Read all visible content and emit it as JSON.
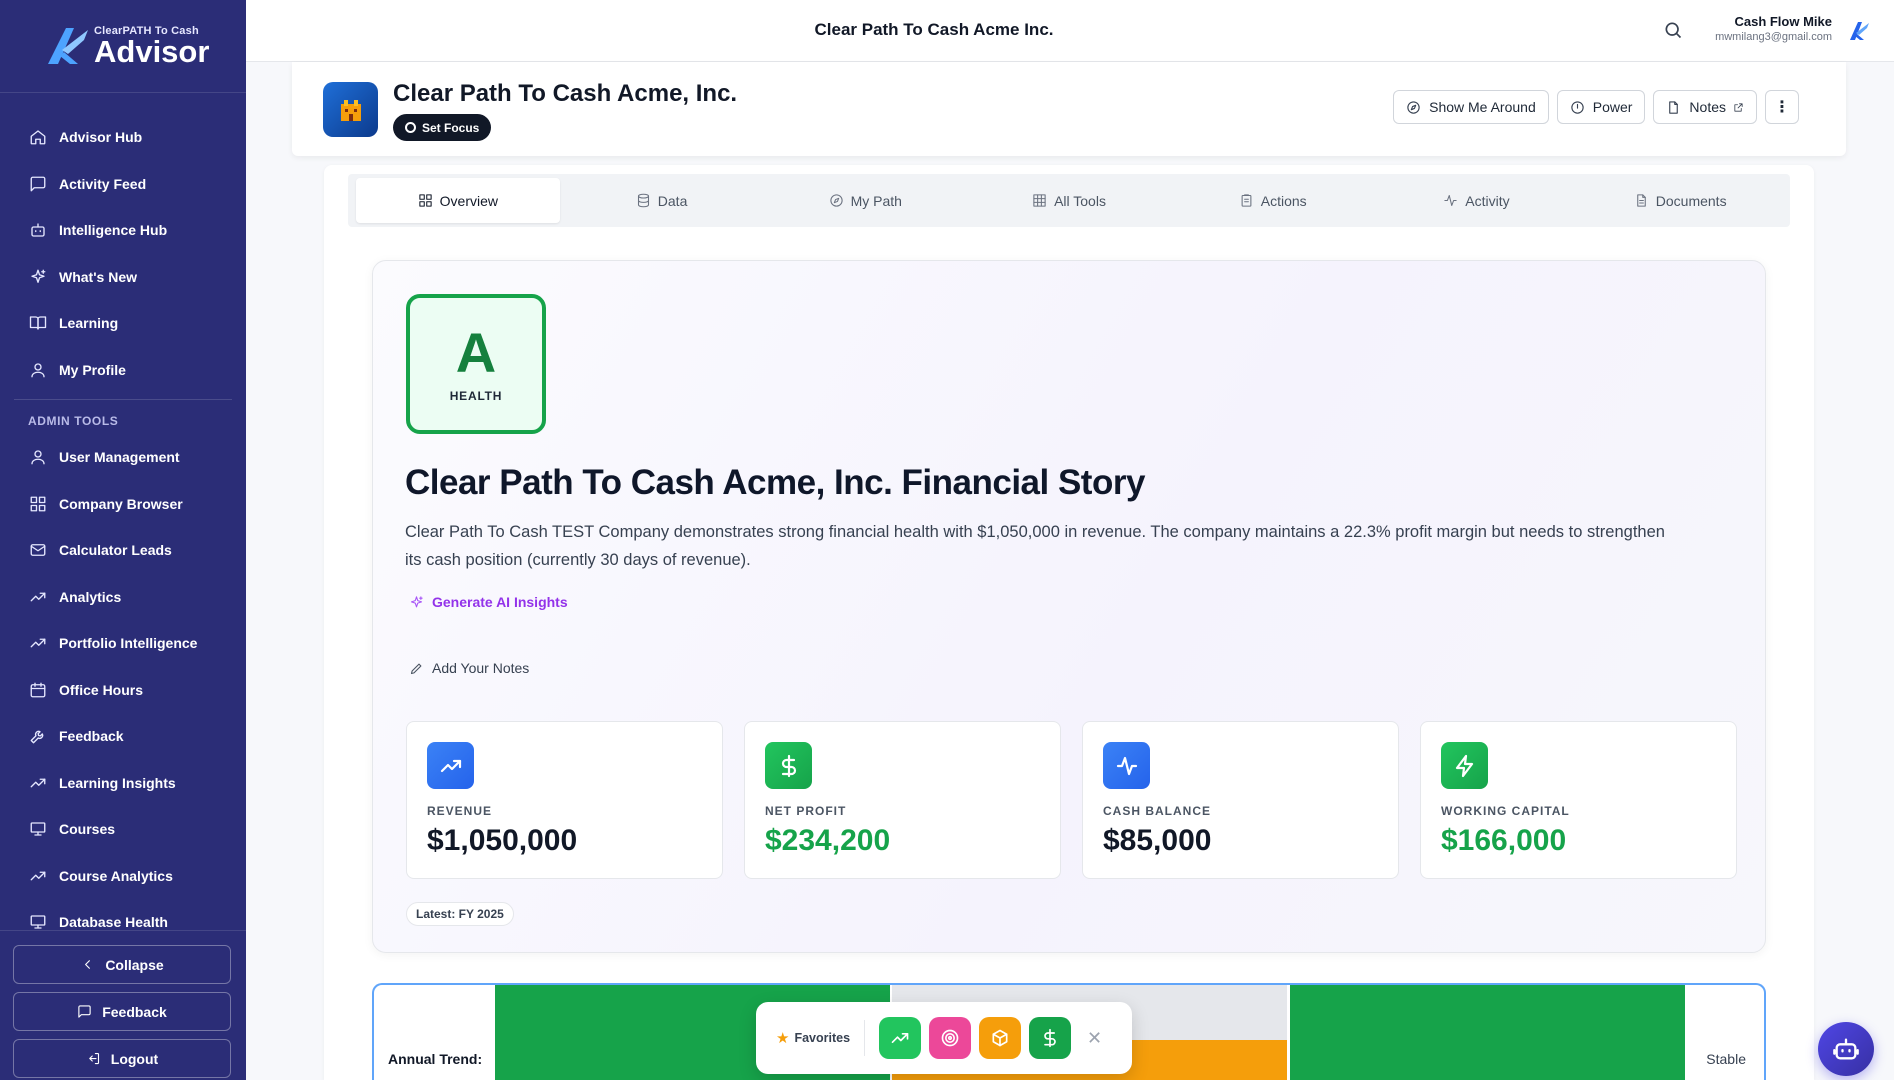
{
  "app": {
    "logo_small": "ClearPATH To Cash",
    "logo_big": "Advisor",
    "top_title": "Clear Path To Cash Acme Inc."
  },
  "user": {
    "name": "Cash Flow Mike",
    "email": "mwmilang3@gmail.com"
  },
  "sidebar": {
    "items": [
      {
        "label": "Advisor Hub",
        "icon": "home-icon"
      },
      {
        "label": "Activity Feed",
        "icon": "message-square-icon"
      },
      {
        "label": "Intelligence Hub",
        "icon": "bot-icon"
      },
      {
        "label": "What's New",
        "icon": "sparkles-icon"
      },
      {
        "label": "Learning",
        "icon": "book-open-icon"
      },
      {
        "label": "My Profile",
        "icon": "user-icon"
      }
    ],
    "admin_label": "ADMIN TOOLS",
    "admin_items": [
      {
        "label": "User Management",
        "icon": "user-icon"
      },
      {
        "label": "Company Browser",
        "icon": "grid-icon"
      },
      {
        "label": "Calculator Leads",
        "icon": "mail-icon"
      },
      {
        "label": "Analytics",
        "icon": "trending-up-icon"
      },
      {
        "label": "Portfolio Intelligence",
        "icon": "trending-up-icon"
      },
      {
        "label": "Office Hours",
        "icon": "calendar-icon"
      },
      {
        "label": "Feedback",
        "icon": "wrench-icon"
      },
      {
        "label": "Learning Insights",
        "icon": "trending-up-icon"
      },
      {
        "label": "Courses",
        "icon": "monitor-icon"
      },
      {
        "label": "Course Analytics",
        "icon": "trending-up-icon"
      },
      {
        "label": "Database Health",
        "icon": "monitor-icon"
      }
    ],
    "collapse_label": "Collapse",
    "feedback_label": "Feedback",
    "logout_label": "Logout"
  },
  "company": {
    "name": "Clear Path To Cash Acme, Inc.",
    "focus_label": "Set Focus",
    "buttons": {
      "tour": "Show Me Around",
      "power": "Power",
      "notes": "Notes"
    }
  },
  "tabs": [
    {
      "label": "Overview",
      "icon": "grid-icon",
      "active": true
    },
    {
      "label": "Data",
      "icon": "database-icon",
      "active": false
    },
    {
      "label": "My Path",
      "icon": "compass-icon",
      "active": false
    },
    {
      "label": "All Tools",
      "icon": "table-icon",
      "active": false
    },
    {
      "label": "Actions",
      "icon": "clipboard-icon",
      "active": false
    },
    {
      "label": "Activity",
      "icon": "activity-icon",
      "active": false
    },
    {
      "label": "Documents",
      "icon": "file-icon",
      "active": false
    }
  ],
  "story": {
    "grade": "A",
    "grade_label": "HEALTH",
    "title": "Clear Path To Cash Acme, Inc. Financial Story",
    "text": "Clear Path To Cash TEST Company demonstrates strong financial health with $1,050,000 in revenue. The company maintains a 22.3% profit margin but needs to strengthen its cash position (currently 30 days of revenue).",
    "ai_link": "Generate AI Insights",
    "notes_link": "Add Your Notes",
    "latest": "Latest: FY 2025"
  },
  "metrics": [
    {
      "label": "REVENUE",
      "value": "$1,050,000",
      "icon": "trending-up-icon",
      "color": "blue",
      "value_color": "dark"
    },
    {
      "label": "NET PROFIT",
      "value": "$234,200",
      "icon": "dollar-icon",
      "color": "green",
      "value_color": "green"
    },
    {
      "label": "CASH BALANCE",
      "value": "$85,000",
      "icon": "activity-icon",
      "color": "blue",
      "value_color": "dark"
    },
    {
      "label": "WORKING CAPITAL",
      "value": "$166,000",
      "icon": "zap-icon",
      "color": "green",
      "value_color": "green"
    }
  ],
  "trend": {
    "label": "Annual Trend:",
    "status": "Stable"
  },
  "favorites": {
    "label": "Favorites",
    "items": [
      {
        "icon": "trending-up-icon",
        "color": "#22c55e"
      },
      {
        "icon": "target-icon",
        "color": "#ec4899"
      },
      {
        "icon": "box-icon",
        "color": "#f59e0b"
      },
      {
        "icon": "dollar-icon",
        "color": "#16a34a"
      }
    ]
  },
  "colors": {
    "sidebar": "#2b2d77",
    "accent_green": "#16a34a",
    "accent_blue": "#2563eb",
    "accent_purple": "#9333ea"
  }
}
